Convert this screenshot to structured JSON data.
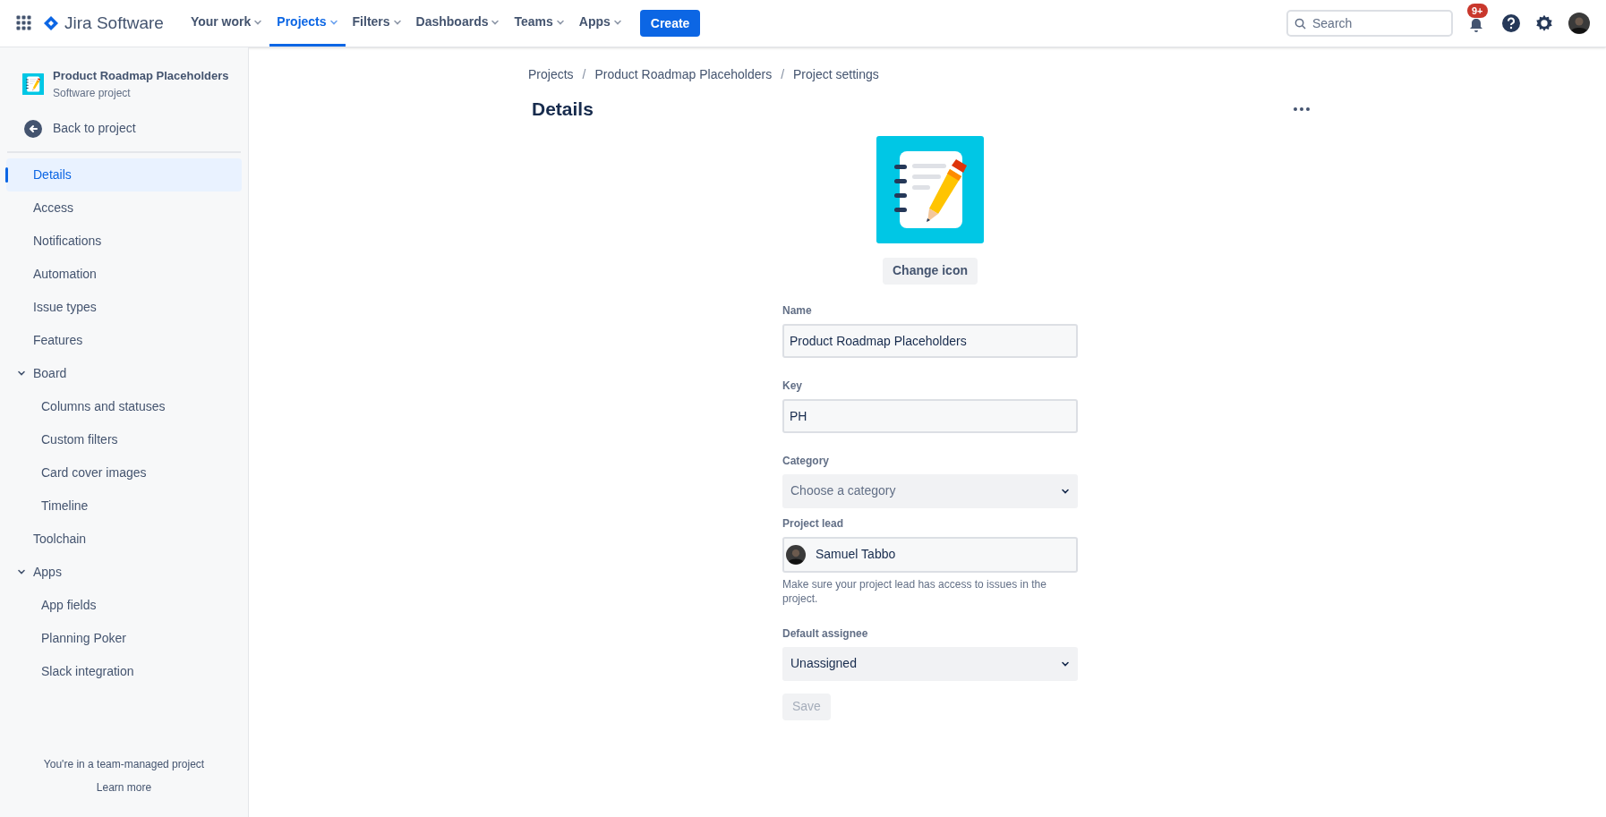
{
  "topbar": {
    "product": "Jira Software",
    "nav": [
      {
        "label": "Your work",
        "selected": false
      },
      {
        "label": "Projects",
        "selected": true
      },
      {
        "label": "Filters",
        "selected": false
      },
      {
        "label": "Dashboards",
        "selected": false
      },
      {
        "label": "Teams",
        "selected": false
      },
      {
        "label": "Apps",
        "selected": false
      }
    ],
    "create_label": "Create",
    "search": {
      "placeholder": "Search"
    },
    "notification_badge": "9+"
  },
  "sidebar": {
    "project_name": "Product Roadmap Placeholders",
    "project_type": "Software project",
    "back_label": "Back to project",
    "items": [
      {
        "label": "Details",
        "selected": true
      },
      {
        "label": "Access",
        "selected": false
      },
      {
        "label": "Notifications",
        "selected": false
      },
      {
        "label": "Automation",
        "selected": false
      },
      {
        "label": "Issue types",
        "selected": false
      },
      {
        "label": "Features",
        "selected": false
      },
      {
        "label": "Board",
        "selected": false,
        "expanded": true,
        "children": [
          {
            "label": "Columns and statuses",
            "selected": false
          },
          {
            "label": "Custom filters",
            "selected": false
          },
          {
            "label": "Card cover images",
            "selected": false
          },
          {
            "label": "Timeline",
            "selected": false
          }
        ]
      },
      {
        "label": "Toolchain",
        "selected": false
      },
      {
        "label": "Apps",
        "selected": false,
        "expanded": true,
        "children": [
          {
            "label": "App fields",
            "selected": false
          },
          {
            "label": "Planning Poker",
            "selected": false
          },
          {
            "label": "Slack integration",
            "selected": false
          }
        ]
      }
    ],
    "footer_note": "You're in a team-managed project",
    "footer_link": "Learn more"
  },
  "breadcrumbs": [
    "Projects",
    "Product Roadmap Placeholders",
    "Project settings"
  ],
  "breadcrumb_separator": "/",
  "page_title": "Details",
  "change_icon_label": "Change icon",
  "fields": [
    {
      "kind": "text",
      "label": "Name",
      "value": "Product Roadmap Placeholders"
    },
    {
      "kind": "text",
      "label": "Key",
      "value": "PH"
    },
    {
      "kind": "select",
      "label": "Category",
      "placeholder": "Choose a category"
    },
    {
      "kind": "user",
      "label": "Project lead",
      "value": "Samuel Tabbo",
      "help": "Make sure your project lead has access to issues in the project."
    },
    {
      "kind": "select",
      "label": "Default assignee",
      "value": "Unassigned"
    }
  ],
  "save": {
    "label": "Save",
    "disabled": true
  }
}
